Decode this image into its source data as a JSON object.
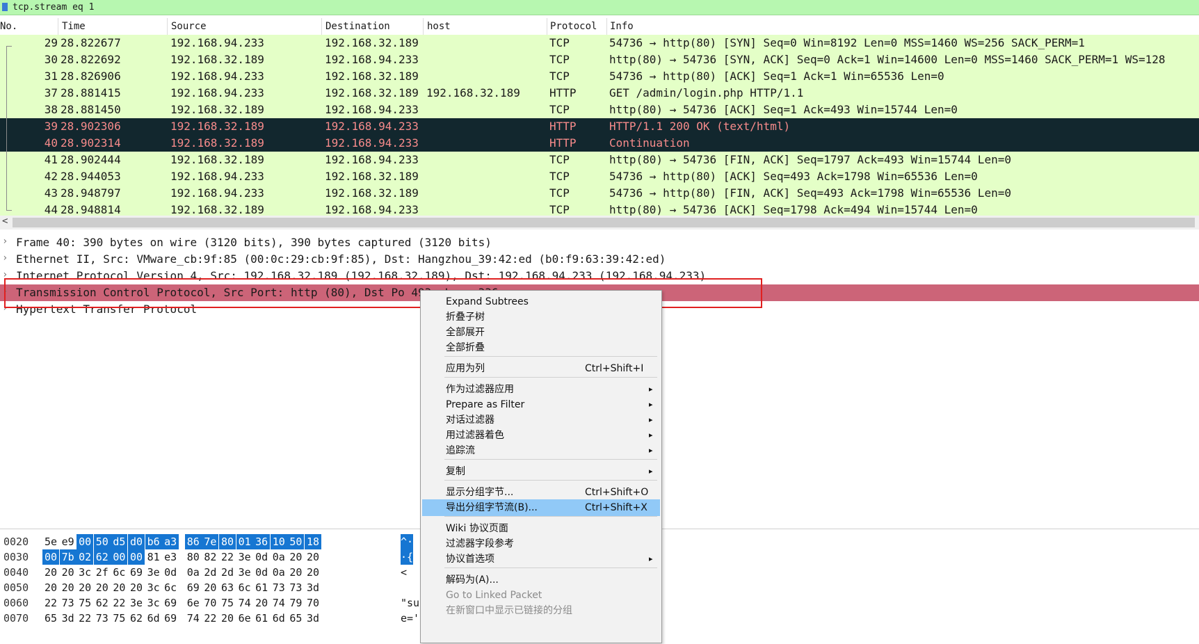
{
  "filter": {
    "text": "tcp.stream eq 1"
  },
  "columns": [
    "No.",
    "Time",
    "Source",
    "Destination",
    "host",
    "Protocol",
    "Info"
  ],
  "packets": [
    {
      "no": "29",
      "time": "28.822677",
      "src": "192.168.94.233",
      "dst": "192.168.32.189",
      "host": "",
      "proto": "TCP",
      "info": "54736 → http(80) [SYN] Seq=0 Win=8192 Len=0 MSS=1460 WS=256 SACK_PERM=1"
    },
    {
      "no": "30",
      "time": "28.822692",
      "src": "192.168.32.189",
      "dst": "192.168.94.233",
      "host": "",
      "proto": "TCP",
      "info": "http(80) → 54736 [SYN, ACK] Seq=0 Ack=1 Win=14600 Len=0 MSS=1460 SACK_PERM=1 WS=128"
    },
    {
      "no": "31",
      "time": "28.826906",
      "src": "192.168.94.233",
      "dst": "192.168.32.189",
      "host": "",
      "proto": "TCP",
      "info": "54736 → http(80) [ACK] Seq=1 Ack=1 Win=65536 Len=0"
    },
    {
      "no": "37",
      "time": "28.881415",
      "src": "192.168.94.233",
      "dst": "192.168.32.189",
      "host": "192.168.32.189",
      "proto": "HTTP",
      "info": "GET /admin/login.php HTTP/1.1"
    },
    {
      "no": "38",
      "time": "28.881450",
      "src": "192.168.32.189",
      "dst": "192.168.94.233",
      "host": "",
      "proto": "TCP",
      "info": "http(80) → 54736 [ACK] Seq=1 Ack=493 Win=15744 Len=0"
    },
    {
      "no": "39",
      "time": "28.902306",
      "src": "192.168.32.189",
      "dst": "192.168.94.233",
      "host": "",
      "proto": "HTTP",
      "info": "HTTP/1.1 200 OK  (text/html)"
    },
    {
      "no": "40",
      "time": "28.902314",
      "src": "192.168.32.189",
      "dst": "192.168.94.233",
      "host": "",
      "proto": "HTTP",
      "info": "Continuation"
    },
    {
      "no": "41",
      "time": "28.902444",
      "src": "192.168.32.189",
      "dst": "192.168.94.233",
      "host": "",
      "proto": "TCP",
      "info": "http(80) → 54736 [FIN, ACK] Seq=1797 Ack=493 Win=15744 Len=0"
    },
    {
      "no": "42",
      "time": "28.944053",
      "src": "192.168.94.233",
      "dst": "192.168.32.189",
      "host": "",
      "proto": "TCP",
      "info": "54736 → http(80) [ACK] Seq=493 Ack=1798 Win=65536 Len=0"
    },
    {
      "no": "43",
      "time": "28.948797",
      "src": "192.168.94.233",
      "dst": "192.168.32.189",
      "host": "",
      "proto": "TCP",
      "info": "54736 → http(80) [FIN, ACK] Seq=493 Ack=1798 Win=65536 Len=0"
    },
    {
      "no": "44",
      "time": "28.948814",
      "src": "192.168.32.189",
      "dst": "192.168.94.233",
      "host": "",
      "proto": "TCP",
      "info": "http(80) → 54736 [ACK] Seq=1798 Ack=494 Win=15744 Len=0"
    }
  ],
  "details": [
    "Frame 40: 390 bytes on wire (3120 bits), 390 bytes captured (3120 bits)",
    "Ethernet II, Src: VMware_cb:9f:85 (00:0c:29:cb:9f:85), Dst: Hangzhou_39:42:ed (b0:f9:63:39:42:ed)",
    "Internet Protocol Version 4, Src: 192.168.32.189 (192.168.32.189), Dst: 192.168.94.233 (192.168.94.233)",
    "Transmission Control Protocol, Src Port: http (80), Dst Po                                          493, Len: 336",
    "Hypertext Transfer Protocol"
  ],
  "hex": [
    {
      "offset": "0020",
      "bytes": [
        "5e",
        "e9",
        "00",
        "50",
        "d5",
        "d0",
        "b6",
        "a3",
        "86",
        "7e",
        "80",
        "01",
        "36",
        "10",
        "50",
        "18"
      ],
      "ascii": "^·"
    },
    {
      "offset": "0030",
      "bytes": [
        "00",
        "7b",
        "02",
        "62",
        "00",
        "00",
        "81",
        "e3",
        "80",
        "82",
        "22",
        "3e",
        "0d",
        "0a",
        "20",
        "20"
      ],
      "ascii": "·{"
    },
    {
      "offset": "0040",
      "bytes": [
        "20",
        "20",
        "3c",
        "2f",
        "6c",
        "69",
        "3e",
        "0d",
        "0a",
        "2d",
        "2d",
        "3e",
        "0d",
        "0a",
        "20",
        "20"
      ],
      "ascii": "<"
    },
    {
      "offset": "0050",
      "bytes": [
        "20",
        "20",
        "20",
        "20",
        "20",
        "20",
        "3c",
        "6c",
        "69",
        "20",
        "63",
        "6c",
        "61",
        "73",
        "73",
        "3d"
      ],
      "ascii": ""
    },
    {
      "offset": "0060",
      "bytes": [
        "22",
        "73",
        "75",
        "62",
        "22",
        "3e",
        "3c",
        "69",
        "6e",
        "70",
        "75",
        "74",
        "20",
        "74",
        "79",
        "70"
      ],
      "ascii": "\"su"
    },
    {
      "offset": "0070",
      "bytes": [
        "65",
        "3d",
        "22",
        "73",
        "75",
        "62",
        "6d",
        "69",
        "74",
        "22",
        "20",
        "6e",
        "61",
        "6d",
        "65",
        "3d"
      ],
      "ascii": "e='"
    }
  ],
  "context_menu": [
    {
      "label": "Expand Subtrees",
      "shortcut": "",
      "submenu": false
    },
    {
      "label": "折叠子树",
      "shortcut": "",
      "submenu": false
    },
    {
      "label": "全部展开",
      "shortcut": "",
      "submenu": false
    },
    {
      "label": "全部折叠",
      "shortcut": "",
      "submenu": false
    },
    {
      "label": "应用为列",
      "shortcut": "Ctrl+Shift+I",
      "submenu": false
    },
    {
      "label": "作为过滤器应用",
      "shortcut": "",
      "submenu": true
    },
    {
      "label": "Prepare as Filter",
      "shortcut": "",
      "submenu": true
    },
    {
      "label": "对话过滤器",
      "shortcut": "",
      "submenu": true
    },
    {
      "label": "用过滤器着色",
      "shortcut": "",
      "submenu": true
    },
    {
      "label": "追踪流",
      "shortcut": "",
      "submenu": true
    },
    {
      "label": "复制",
      "shortcut": "",
      "submenu": true
    },
    {
      "label": "显示分组字节...",
      "shortcut": "Ctrl+Shift+O",
      "submenu": false
    },
    {
      "label": "导出分组字节流(B)...",
      "shortcut": "Ctrl+Shift+X",
      "submenu": false
    },
    {
      "label": "Wiki 协议页面",
      "shortcut": "",
      "submenu": false
    },
    {
      "label": "过滤器字段参考",
      "shortcut": "",
      "submenu": false
    },
    {
      "label": "协议首选项",
      "shortcut": "",
      "submenu": true
    },
    {
      "label": "解码为(A)...",
      "shortcut": "",
      "submenu": false
    },
    {
      "label": "Go to Linked Packet",
      "shortcut": "",
      "submenu": false
    },
    {
      "label": "在新窗口中显示已链接的分组",
      "shortcut": "",
      "submenu": false
    }
  ],
  "colors": {
    "packet_row": "#e4ffc7",
    "selected_row": "#12272e",
    "selected_row_text": "#f78b8b",
    "detail_selected": "#cc6478",
    "hex_selected": "#1676d2",
    "menu_highlight": "#91c9f7"
  },
  "icons": {
    "filter": "bookmark-icon",
    "expand": "chevron-right-icon",
    "submenu": "triangle-right-icon"
  }
}
